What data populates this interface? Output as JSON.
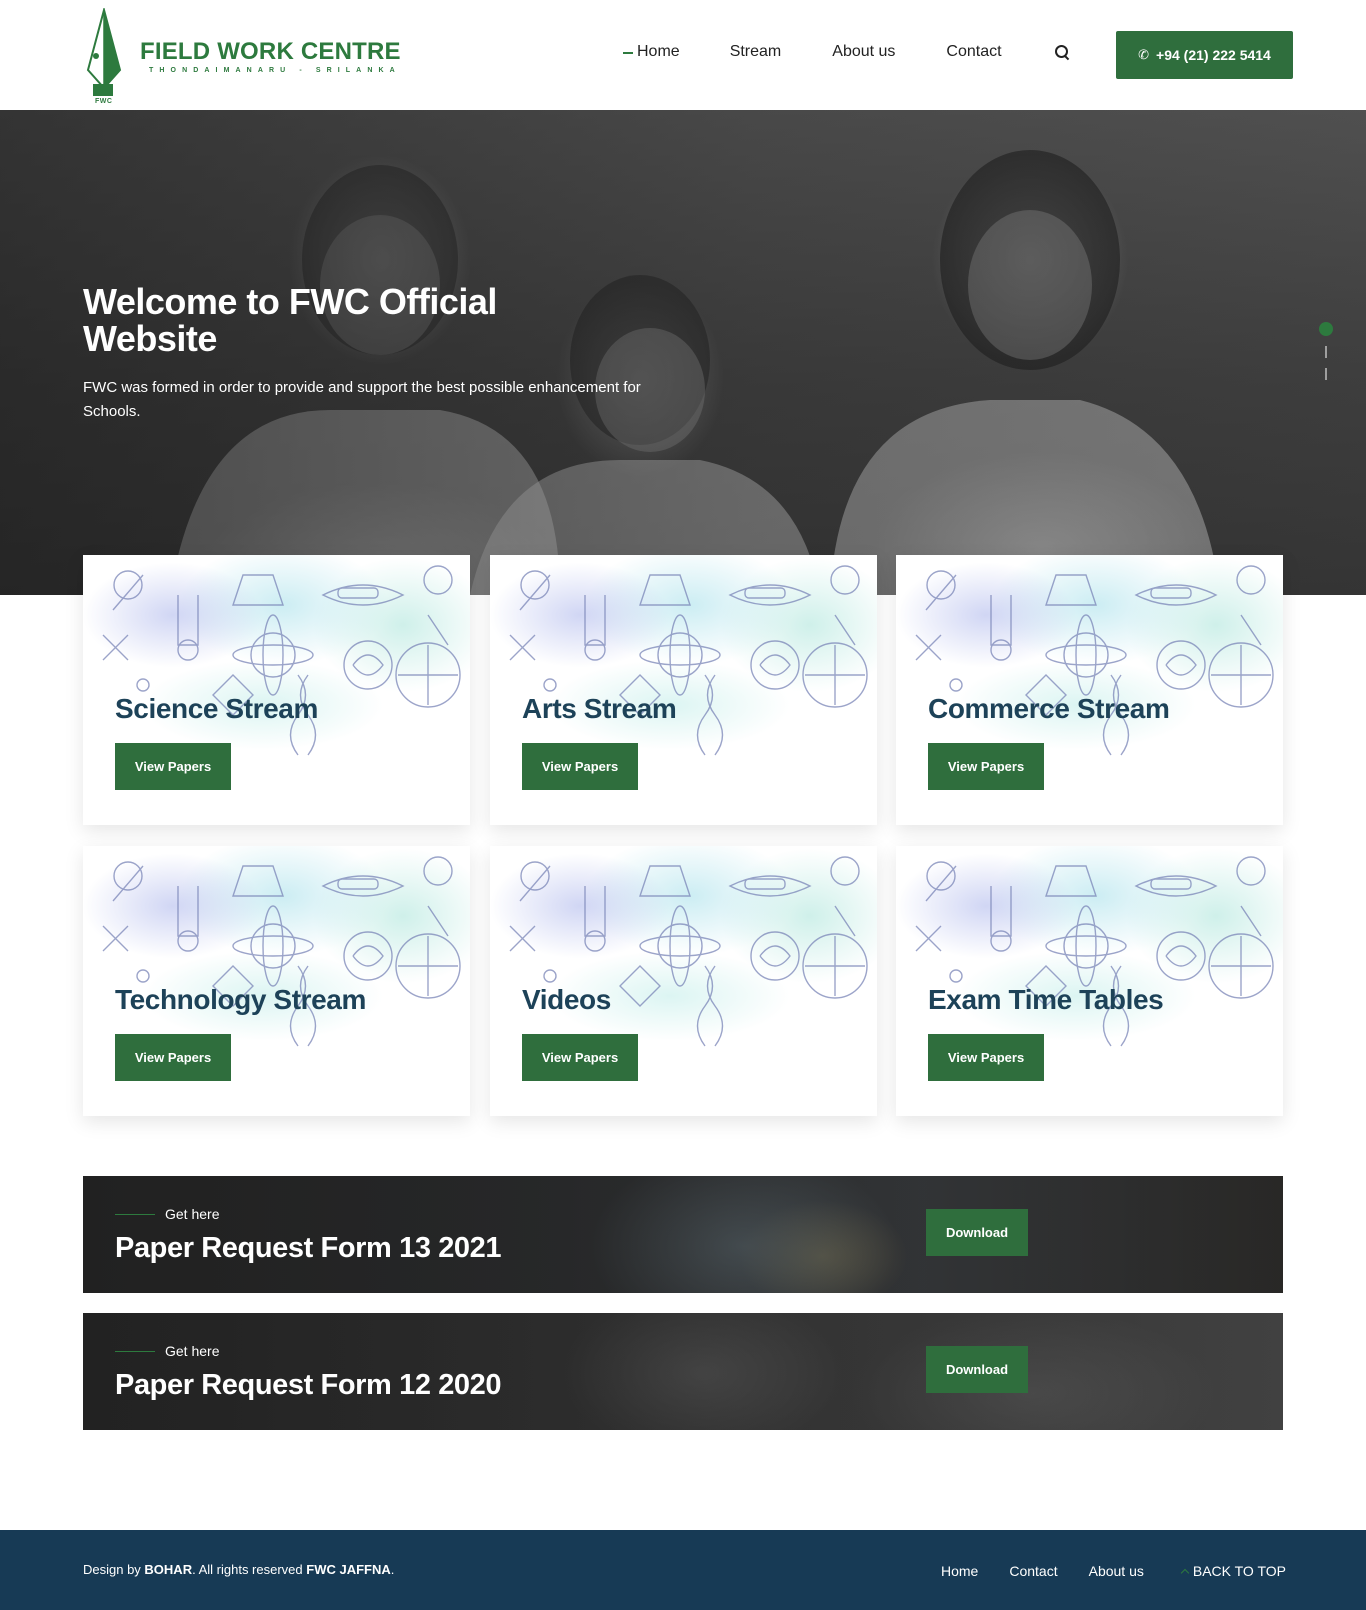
{
  "brand": {
    "title": "FIELD WORK CENTRE",
    "subtitle": "THONDAIMANARU - SRILANKA",
    "abbr": "FWC",
    "color": "#2d7a3e"
  },
  "nav": {
    "items": [
      "Home",
      "Stream",
      "About us",
      "Contact"
    ],
    "active": "Home",
    "search_icon": "search-icon",
    "phone_icon": "phone-icon",
    "phone": "+94 (21) 222 5414"
  },
  "hero": {
    "title": "Welcome to FWC Official Website",
    "text": "FWC was formed in order to provide and support the best possible enhancement for Schools.",
    "slide_count": 3,
    "active_slide": 1
  },
  "cards": [
    {
      "title": "Science Stream",
      "button": "View Papers"
    },
    {
      "title": "Arts Stream",
      "button": "View Papers"
    },
    {
      "title": "Commerce Stream",
      "button": "View Papers"
    },
    {
      "title": "Technology Stream",
      "button": "View Papers"
    },
    {
      "title": "Videos",
      "button": "View Papers"
    },
    {
      "title": "Exam Time Tables",
      "button": "View Papers"
    }
  ],
  "downloads": [
    {
      "kicker": "Get here",
      "title": "Paper Request Form 13 2021",
      "button": "Download"
    },
    {
      "kicker": "Get here",
      "title": "Paper Request Form 12 2020",
      "button": "Download"
    }
  ],
  "footer": {
    "copy_prefix": "Design by ",
    "designer": "BOHAR",
    "copy_middle": ". All rights reserved ",
    "owner": "FWC JAFFNA",
    "copy_suffix": ".",
    "links": [
      "Home",
      "Contact",
      "About us"
    ],
    "back_to_top": "BACK TO TOP"
  },
  "colors": {
    "primary_green": "#2f6e3d",
    "heading_navy": "#1d4258",
    "footer_bg": "#173a55"
  }
}
